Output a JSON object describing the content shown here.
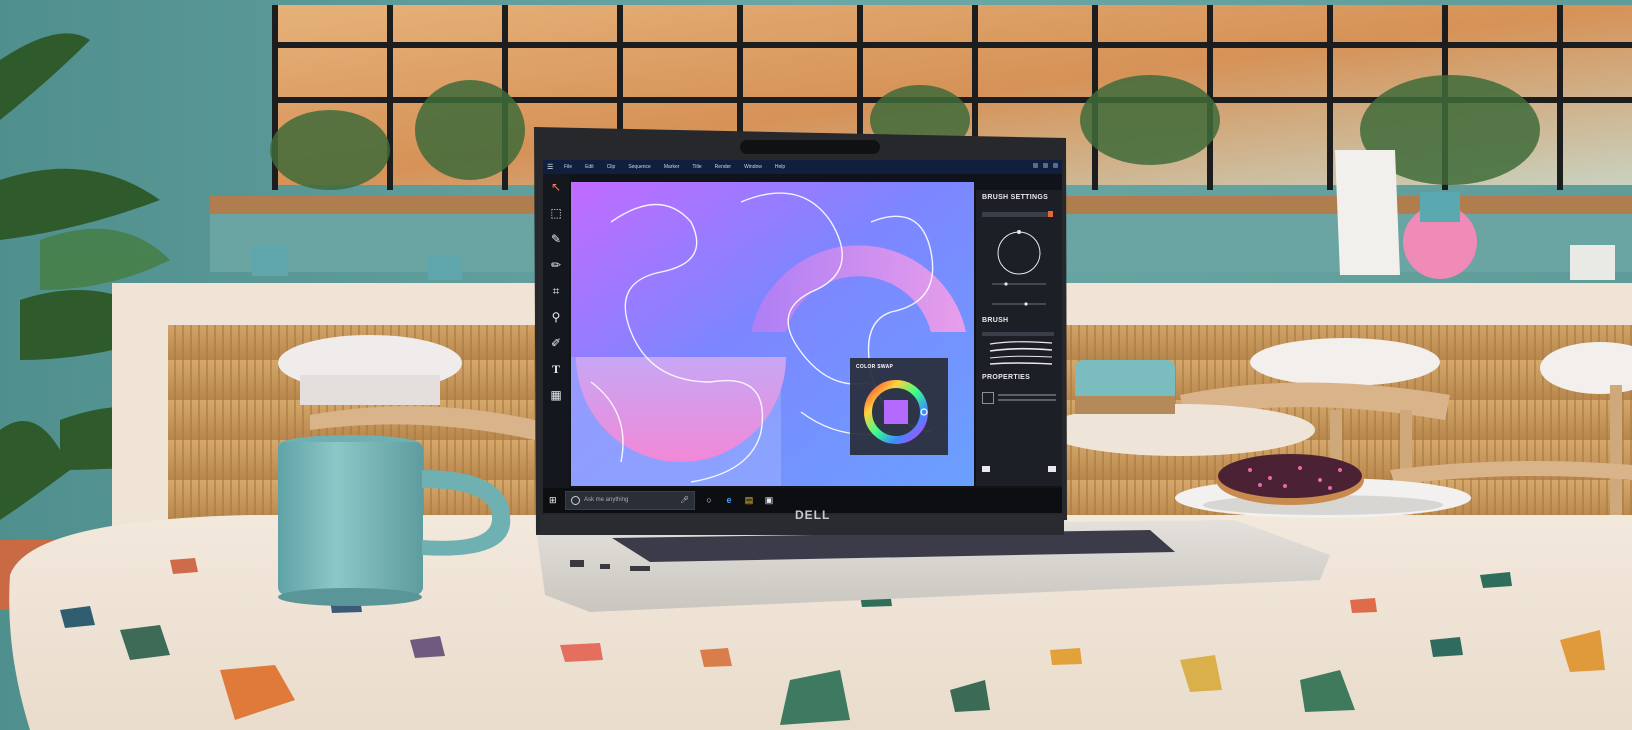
{
  "scene": {
    "description_colors": {
      "wall": "#5f9e9c",
      "counter_wood": "#c99a5c",
      "table_top": "#efe4d6",
      "laptop_silver": "#d9d6d2",
      "mug": "#7fbcbd"
    }
  },
  "laptop": {
    "brand": "DELL",
    "app": {
      "menu": [
        "File",
        "Edit",
        "Clip",
        "Sequence",
        "Marker",
        "Title",
        "Render",
        "Window",
        "Help"
      ],
      "tools": [
        "pointer-tool-icon",
        "select-tool-icon",
        "brush-tool-icon",
        "pencil-tool-icon",
        "crop-tool-icon",
        "zoom-tool-icon",
        "eyedropper-tool-icon",
        "text-tool-icon",
        "layer-tool-icon"
      ],
      "tool_glyphs": [
        "↖",
        "⬚",
        "✎",
        "✏",
        "⌗",
        "⚲",
        "✐",
        "T",
        "▦"
      ],
      "panel": {
        "brush_settings_title": "BRUSH SETTINGS",
        "brush_title": "BRUSH",
        "properties_title": "PROPERTIES"
      },
      "color_swap_title": "COLOR SWAP",
      "swatch_color": "#b469ff"
    },
    "taskbar": {
      "search_placeholder": "Ask me anything"
    }
  }
}
